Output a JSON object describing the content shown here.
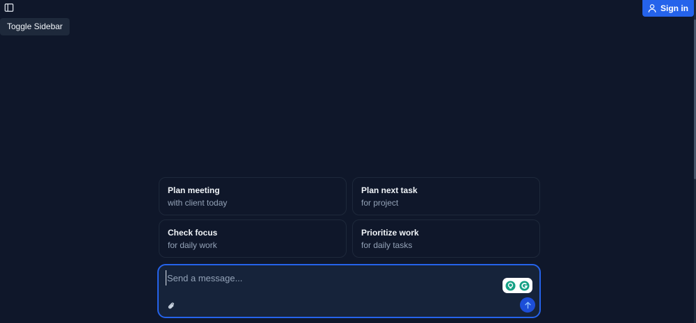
{
  "sidebar_toggle": {
    "icon": "sidebar-toggle-icon",
    "tooltip": "Toggle Sidebar"
  },
  "auth": {
    "sign_in_label": "Sign in",
    "icon": "user-icon"
  },
  "suggestions": [
    {
      "title": "Plan meeting",
      "subtitle": "with client today"
    },
    {
      "title": "Plan next task",
      "subtitle": "for project"
    },
    {
      "title": "Check focus",
      "subtitle": "for daily work"
    },
    {
      "title": "Prioritize work",
      "subtitle": "for daily tasks"
    }
  ],
  "composer": {
    "placeholder": "Send a message...",
    "value": "",
    "attach_icon": "paperclip-icon",
    "send_icon": "arrow-up-icon"
  },
  "colors": {
    "background": "#0f172a",
    "accent": "#2563eb",
    "composer_bg": "#16233a",
    "muted_text": "#94a3b8"
  }
}
